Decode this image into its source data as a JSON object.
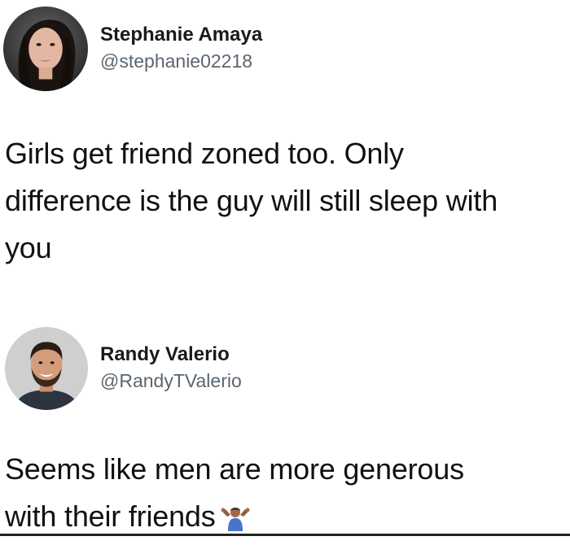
{
  "tweets": [
    {
      "author": {
        "name": "Stephanie Amaya",
        "handle": "@stephanie02218"
      },
      "text_lines": [
        "Girls get friend zoned too. Only",
        "difference is the guy will still sleep with",
        "you"
      ]
    },
    {
      "author": {
        "name": "Randy Valerio",
        "handle": "@RandyTValerio"
      },
      "text_lines": [
        "Seems like men are more generous",
        "with their friends"
      ],
      "emoji": "man-shrugging-icon"
    }
  ]
}
